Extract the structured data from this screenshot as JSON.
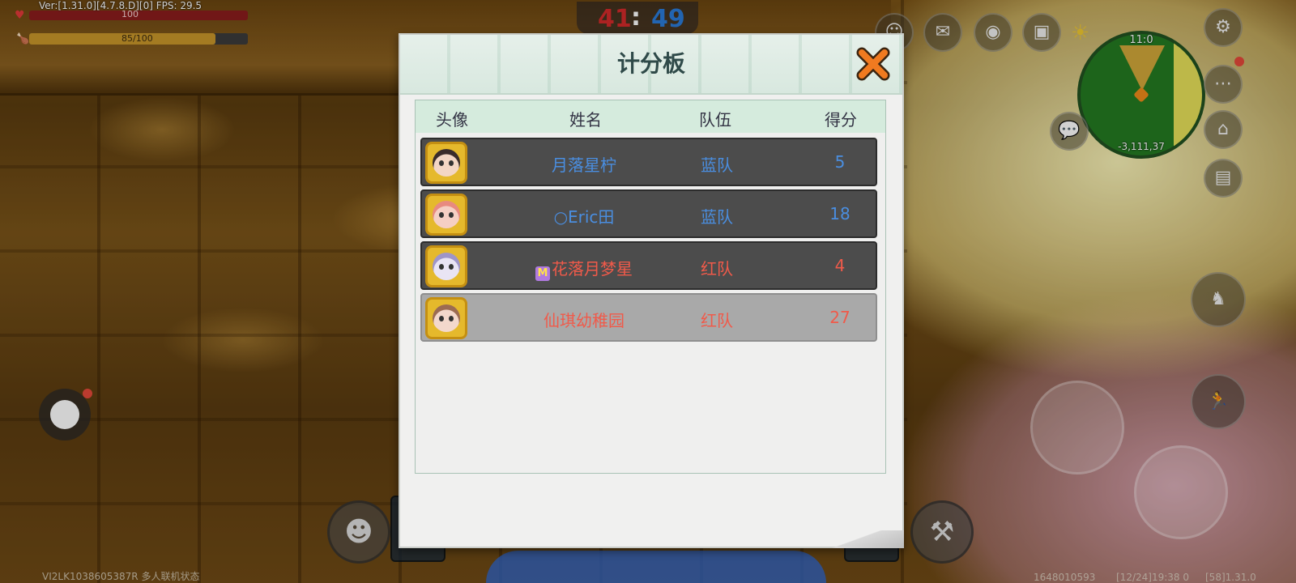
{
  "hud": {
    "version_text": "Ver:[1.31.0][4.7.8.D][0] FPS: 29.5",
    "hp_text": "100",
    "hunger_text": "85/100",
    "hunger_value": 0.85,
    "team_score_red": "41",
    "team_score_sep": ":",
    "team_score_blue": "49",
    "minimap_time": "11:0",
    "minimap_coords": "-3,111,37",
    "bottom_left_text": "VI2LK1038605387R 多人联机状态",
    "bottom_right_uid": "1648010593",
    "bottom_right_time": "[12/24]19:38 0",
    "bottom_right_ver": "[58]1.31.0"
  },
  "scoreboard": {
    "title": "计分板",
    "headers": {
      "avatar": "头像",
      "name": "姓名",
      "team": "队伍",
      "score": "得分"
    },
    "rows": [
      {
        "name": "月落星柠",
        "team": "蓝队",
        "score": "5",
        "team_color": "#4a8ee0",
        "skin": "#f3d6c4",
        "hair": "#3a2c2a"
      },
      {
        "name": "○Eric田",
        "team": "蓝队",
        "score": "18",
        "team_color": "#4a8ee0",
        "skin": "#f5cfc4",
        "hair": "#e88a80"
      },
      {
        "name": "花落月梦星",
        "team": "红队",
        "score": "4",
        "team_color": "#f05a4a",
        "skin": "#e9e4f4",
        "hair": "#9e95c9"
      },
      {
        "name": "仙琪幼稚园",
        "team": "红队",
        "score": "27",
        "team_color": "#f05a4a",
        "skin": "#f3d8cc",
        "hair": "#9b6b52"
      }
    ]
  },
  "colors": {
    "accent_close": "#f07a20",
    "blue_team": "#4a8ee0",
    "red_team": "#f05a4a"
  }
}
